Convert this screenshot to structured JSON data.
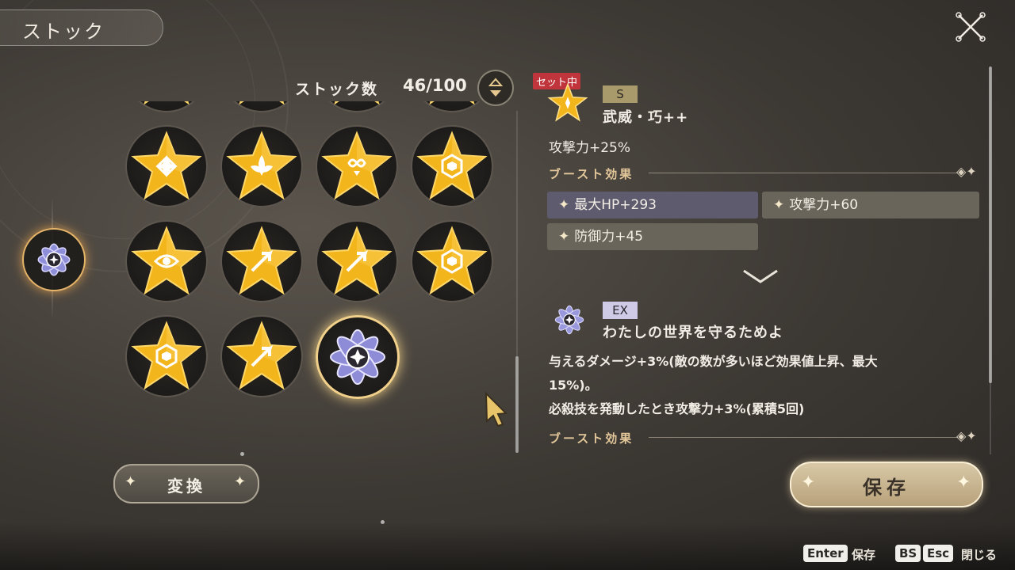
{
  "header": {
    "title": "ストック"
  },
  "stock": {
    "label": "ストック数",
    "count": "46/100"
  },
  "grid": {
    "selected_index": 10,
    "items": [
      {
        "type": "gold",
        "icon": "shuriken"
      },
      {
        "type": "gold",
        "icon": "shield"
      },
      {
        "type": "gold",
        "icon": "arrow"
      },
      {
        "type": "gold",
        "icon": "shield"
      },
      {
        "type": "gold",
        "icon": "shuriken"
      },
      {
        "type": "gold",
        "icon": "leaf"
      },
      {
        "type": "gold",
        "icon": "infinity"
      },
      {
        "type": "gold",
        "icon": "hexagon"
      },
      {
        "type": "gold",
        "icon": "eye"
      },
      {
        "type": "gold",
        "icon": "arrow"
      },
      {
        "type": "gold",
        "icon": "arrow"
      },
      {
        "type": "gold",
        "icon": "hexagon"
      },
      {
        "type": "gold",
        "icon": "hexagon"
      },
      {
        "type": "gold",
        "icon": "arrow"
      },
      {
        "type": "ex",
        "icon": "flower"
      }
    ]
  },
  "buttons": {
    "convert": "変換",
    "save": "保存"
  },
  "detail": {
    "set_badge": "セット中",
    "item1": {
      "rank": "S",
      "name": "武威・巧++",
      "stat": "攻撃力+25%",
      "boost_label": "ブースト効果",
      "boosts": [
        "最大HP+293",
        "攻撃力+60",
        "防御力+45"
      ]
    },
    "item2": {
      "rank": "EX",
      "name": "わたしの世界を守るためよ",
      "desc_line1": "与えるダメージ+3%(敵の数が多いほど効果値上昇、最大",
      "desc_line2": "15%)。",
      "desc_line3": "必殺技を発動したとき攻撃力+3%(累積5回)",
      "boost_label": "ブースト効果"
    }
  },
  "hints": {
    "enter_key": "Enter",
    "enter_label": "保存",
    "bs_key": "BS",
    "esc_key": "Esc",
    "close_label": "閉じる"
  },
  "colors": {
    "gold": "#f3b51c",
    "accent": "#e3c79a",
    "set_badge": "#c0343c"
  }
}
